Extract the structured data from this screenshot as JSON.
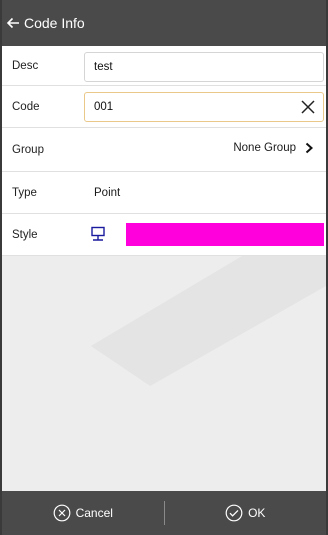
{
  "header": {
    "title": "Code Info"
  },
  "form": {
    "desc": {
      "label": "Desc",
      "value": "test"
    },
    "code": {
      "label": "Code",
      "value": "001"
    },
    "group": {
      "label": "Group",
      "value": "None Group"
    },
    "type": {
      "label": "Type",
      "value": "Point"
    },
    "style": {
      "label": "Style",
      "icon_color": "#1a1a9e",
      "swatch_color": "#ff00dd"
    }
  },
  "footer": {
    "cancel_label": "Cancel",
    "ok_label": "OK"
  },
  "colors": {
    "bar": "#4a4a4a",
    "focus_border": "#e9c88a"
  },
  "icons": [
    "back-arrow-icon",
    "clear-icon",
    "chevron-right-icon",
    "point-style-icon",
    "cancel-circle-icon",
    "ok-check-circle-icon"
  ]
}
